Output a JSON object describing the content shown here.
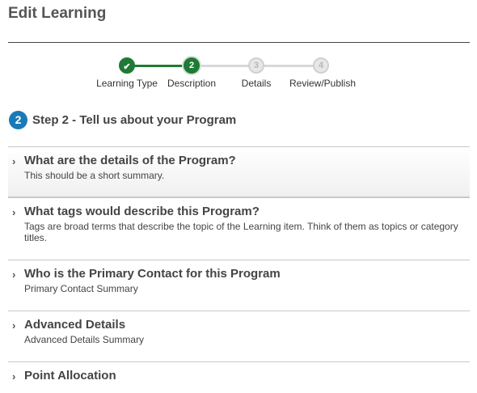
{
  "page": {
    "title": "Edit Learning"
  },
  "stepper": {
    "steps": [
      {
        "number": "",
        "label": "Learning Type",
        "state": "completed",
        "icon": "check-icon"
      },
      {
        "number": "2",
        "label": "Description",
        "state": "current"
      },
      {
        "number": "3",
        "label": "Details",
        "state": "upcoming"
      },
      {
        "number": "4",
        "label": "Review/Publish",
        "state": "upcoming"
      }
    ],
    "colors": {
      "completed": "#1f7a35",
      "upcoming": "#d8d8d8"
    }
  },
  "step_heading": {
    "number": "2",
    "text": "Step 2 - Tell us about your Program",
    "badge_color": "#1a7ab8"
  },
  "sections": [
    {
      "title": "What are the details of the Program?",
      "summary": "This should be a short summary.",
      "active": true
    },
    {
      "title": "What tags would describe this Program?",
      "summary": "Tags are broad terms that describe the topic of the Learning item. Think of them as topics or category titles.",
      "active": false
    },
    {
      "title": "Who is the Primary Contact for this Program",
      "summary": "Primary Contact Summary",
      "active": false
    },
    {
      "title": "Advanced Details",
      "summary": "Advanced Details Summary",
      "active": false
    },
    {
      "title": "Point Allocation",
      "summary": "",
      "active": false
    }
  ],
  "icons": {
    "section_toggle": "chevron-right-icon",
    "completed_step": "check-icon"
  }
}
